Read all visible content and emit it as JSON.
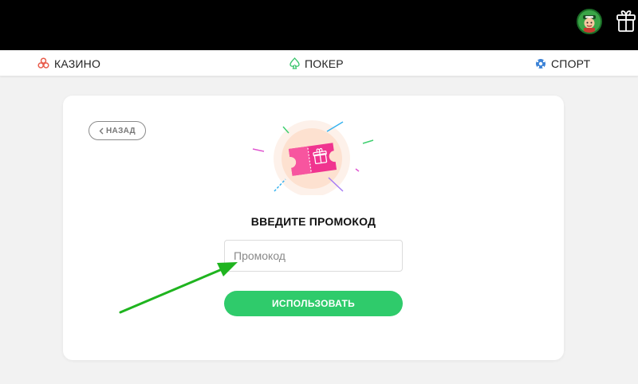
{
  "header": {
    "avatar_icon": "user-avatar-icon",
    "gift_icon": "gift-icon"
  },
  "nav": {
    "items": [
      {
        "label": "КАЗИНО",
        "icon": "casino-icon"
      },
      {
        "label": "ПОКЕР",
        "icon": "spade-icon"
      },
      {
        "label": "СПОРТ",
        "icon": "soccer-ball-icon"
      }
    ]
  },
  "promo": {
    "back_label": "НАЗАД",
    "title": "ВВЕДИТЕ ПРОМОКОД",
    "input_placeholder": "Промокод",
    "input_value": "",
    "submit_label": "ИСПОЛЬЗОВАТЬ"
  },
  "colors": {
    "topbar": "#000000",
    "accent_green": "#2fcb6b",
    "arrow_green": "#1fb41f",
    "ticket_pink": "#f0348f"
  }
}
